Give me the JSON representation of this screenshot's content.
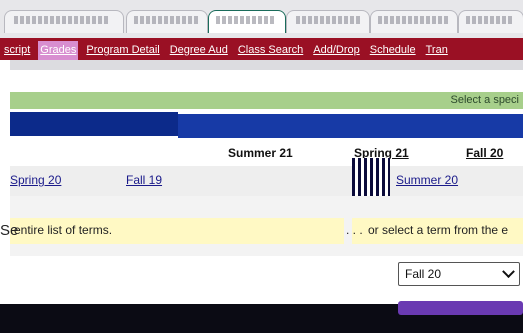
{
  "nav": {
    "items": [
      {
        "label": "script",
        "active": false
      },
      {
        "label": "Grades",
        "active": true
      },
      {
        "label": "Program Detail",
        "active": false
      },
      {
        "label": "Degree Aud",
        "active": false
      },
      {
        "label": "Class Search",
        "active": false
      },
      {
        "label": "Add/Drop",
        "active": false
      },
      {
        "label": "Schedule",
        "active": false
      },
      {
        "label": "Tran",
        "active": false
      }
    ]
  },
  "banner": {
    "hint": "Select a speci"
  },
  "terms": {
    "row1": [
      "Summer 21",
      "Spring 21",
      "Fall 20"
    ],
    "row2": [
      "Spring 20",
      "Fall 19",
      "Summer 20"
    ]
  },
  "info": {
    "left": "entire list of terms.",
    "left_prefix": "Se",
    "ellipsis": ". . .",
    "right": "or select a term from the e"
  },
  "select": {
    "value": "Fall 20"
  },
  "colors": {
    "nav": "#9a1024",
    "active_tab": "#d88ed0",
    "blue_band": "#0c2a8a",
    "green_band": "#a7cf8b",
    "yellow": "#fff9c4"
  }
}
